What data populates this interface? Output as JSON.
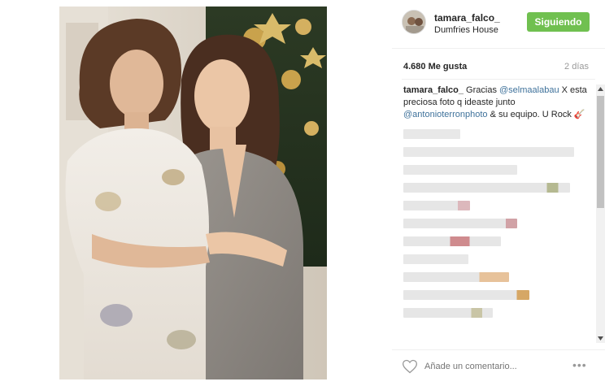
{
  "post": {
    "photo_alt": "Two women posing in front of a Christmas tree"
  },
  "header": {
    "username": "tamara_falco_",
    "location": "Dumfries House",
    "follow_label": "Siguiendo"
  },
  "stats": {
    "likes": "4.680 Me gusta",
    "time": "2 días"
  },
  "caption": {
    "user": "tamara_falco_",
    "text_1": " Gracias ",
    "mention_1": "@selmaalabau",
    "text_2": " X esta preciosa foto q ideaste junto ",
    "mention_2": "@antonioterronphoto",
    "text_3": " & su equipo. U Rock ",
    "emoji": "🎸"
  },
  "footer": {
    "comment_placeholder": "Añade un comentario...",
    "more_label": "•••"
  },
  "colors": {
    "follow_green": "#70c050",
    "mention_blue": "#3f729b"
  }
}
